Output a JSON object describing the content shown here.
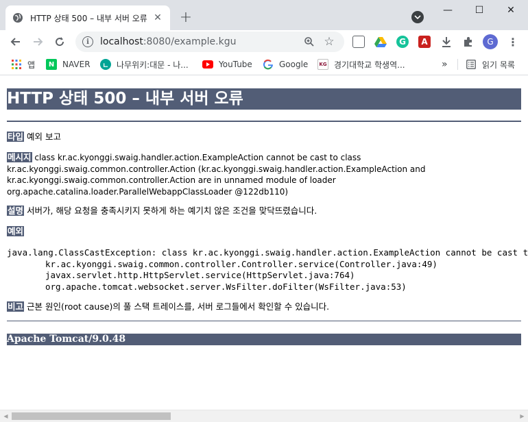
{
  "window": {
    "tab_title": "HTTP 상태 500 – 내부 서버 오류",
    "new_tab": "+",
    "minimize": "—",
    "maximize": "☐",
    "close": "✕"
  },
  "toolbar": {
    "url_host": "localhost",
    "url_rest": ":8080/example.kgu",
    "avatar_letter": "G"
  },
  "bookmarks": [
    {
      "label": "앱",
      "icon": "apps-grid-icon"
    },
    {
      "label": "NAVER",
      "icon": "naver-icon"
    },
    {
      "label": "나무위키:대문 - 나...",
      "icon": "namuwiki-icon"
    },
    {
      "label": "YouTube",
      "icon": "youtube-icon"
    },
    {
      "label": "Google",
      "icon": "google-icon"
    },
    {
      "label": "경기대학교 학생역...",
      "icon": "kgu-icon"
    }
  ],
  "bookmarks_more": "»",
  "reading_list": "읽기 목록",
  "error_page": {
    "title": "HTTP 상태 500 – 내부 서버 오류",
    "type_label": "타입",
    "type_value": "예외 보고",
    "message_label": "메시지",
    "message_line1": "class kr.ac.kyonggi.swaig.handler.action.ExampleAction cannot be cast to class",
    "message_line2": "kr.ac.kyonggi.swaig.common.controller.Action (kr.ac.kyonggi.swaig.handler.action.ExampleAction and",
    "message_line3": "kr.ac.kyonggi.swaig.common.controller.Action are in unnamed module of loader",
    "message_line4": "org.apache.catalina.loader.ParallelWebappClassLoader @122db110)",
    "description_label": "설명",
    "description_value": "서버가, 해당 요청을 충족시키지 못하게 하는 예기치 않은 조건을 맞닥뜨렸습니다.",
    "exception_label": "예외",
    "stack_trace": [
      "java.lang.ClassCastException: class kr.ac.kyonggi.swaig.handler.action.ExampleAction cannot be cast to class",
      "\tkr.ac.kyonggi.swaig.common.controller.Controller.service(Controller.java:49)",
      "\tjavax.servlet.http.HttpServlet.service(HttpServlet.java:764)",
      "\torg.apache.tomcat.websocket.server.WsFilter.doFilter(WsFilter.java:53)"
    ],
    "note_label": "비고",
    "note_value": "근본 원인(root cause)의 풀 스택 트레이스를, 서버 로그들에서 확인할 수 있습니다.",
    "footer": "Apache Tomcat/9.0.48"
  },
  "colors": {
    "tomcat_slate": "#525d76",
    "tab_strip": "#dee1e6",
    "omnibox": "#f1f3f4"
  }
}
